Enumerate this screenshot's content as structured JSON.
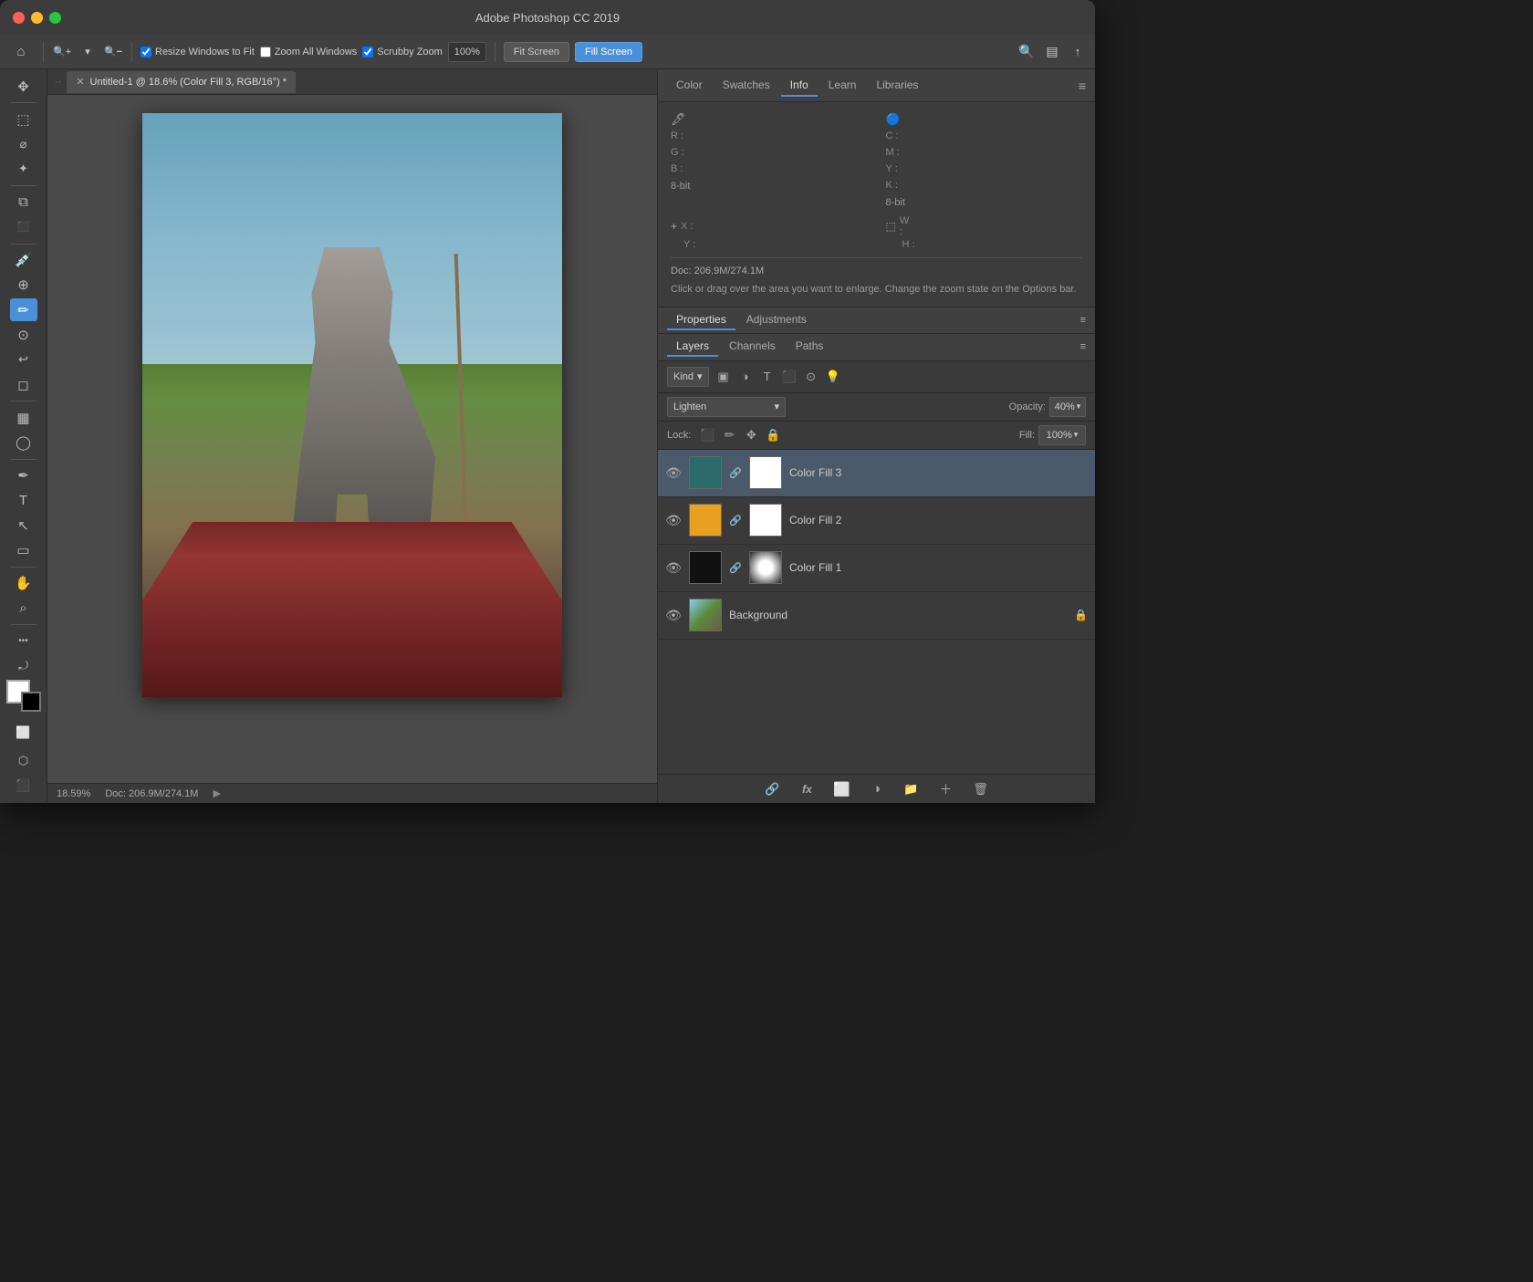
{
  "app": {
    "title": "Adobe Photoshop CC 2019"
  },
  "titlebar": {
    "title": "Adobe Photoshop CC 2019"
  },
  "optionsbar": {
    "home_icon": "⌂",
    "zoom_in_icon": "🔍",
    "zoom_out_icon": "🔍",
    "resize_windows_label": "Resize Windows to Fit",
    "resize_windows_checked": true,
    "zoom_all_windows_label": "Zoom All Windows",
    "zoom_all_windows_checked": false,
    "scrubby_zoom_label": "Scrubby Zoom",
    "scrubby_zoom_checked": true,
    "zoom_level": "100%",
    "fit_screen_label": "Fit Screen",
    "fill_screen_label": "Fill Screen",
    "search_icon": "🔍",
    "arrange_icon": "▤",
    "share_icon": "↑"
  },
  "canvas": {
    "tab_title": "Untitled-1 @ 18.6% (Color Fill 3, RGB/16°) *",
    "zoom_percent": "18.59%",
    "doc_info": "Doc: 206.9M/274.1M"
  },
  "panel_tabs": {
    "items": [
      {
        "label": "Color",
        "id": "color"
      },
      {
        "label": "Swatches",
        "id": "swatches"
      },
      {
        "label": "Info",
        "id": "info",
        "active": true
      },
      {
        "label": "Learn",
        "id": "learn"
      },
      {
        "label": "Libraries",
        "id": "libraries"
      }
    ]
  },
  "info_panel": {
    "r_label": "R :",
    "g_label": "G :",
    "b_label": "B :",
    "c_label": "C :",
    "m_label": "M :",
    "y_label": "Y :",
    "k_label": "K :",
    "bitdepth1": "8-bit",
    "bitdepth2": "8-bit",
    "x_label": "X :",
    "y_label2": "Y :",
    "w_label": "W :",
    "h_label": "H :",
    "doc_text": "Doc: 206.9M/274.1M",
    "hint_text": "Click or drag over the area you want to enlarge. Change the zoom state on the Options bar."
  },
  "properties_tabs": {
    "items": [
      {
        "label": "Properties",
        "id": "properties",
        "active": true
      },
      {
        "label": "Adjustments",
        "id": "adjustments"
      }
    ]
  },
  "layers_tabs": {
    "items": [
      {
        "label": "Layers",
        "id": "layers",
        "active": true
      },
      {
        "label": "Channels",
        "id": "channels"
      },
      {
        "label": "Paths",
        "id": "paths"
      }
    ]
  },
  "layers_toolbar": {
    "filter_kind_label": "Kind",
    "filter_dropdown_arrow": "▾",
    "blend_mode": "Lighten",
    "opacity_label": "Opacity:",
    "opacity_value": "40%",
    "lock_label": "Lock:",
    "fill_label": "Fill:",
    "fill_value": "100%"
  },
  "layers": [
    {
      "id": "color-fill-3",
      "name": "Color Fill 3",
      "thumb_color": "#2a6a6a",
      "selected": true,
      "has_mask": true
    },
    {
      "id": "color-fill-2",
      "name": "Color Fill 2",
      "thumb_color": "#e8a020",
      "selected": false,
      "has_mask": true
    },
    {
      "id": "color-fill-1",
      "name": "Color Fill 1",
      "thumb_color": "#111111",
      "selected": false,
      "has_mask": true
    },
    {
      "id": "background",
      "name": "Background",
      "thumb_color": "photo",
      "selected": false,
      "has_mask": false,
      "has_lock": true
    }
  ],
  "layers_bottom_icons": [
    {
      "name": "link-icon",
      "glyph": "🔗"
    },
    {
      "name": "fx-icon",
      "glyph": "fx"
    },
    {
      "name": "mask-icon",
      "glyph": "⬜"
    },
    {
      "name": "adjustment-icon",
      "glyph": "◑"
    },
    {
      "name": "folder-icon",
      "glyph": "📁"
    },
    {
      "name": "new-layer-icon",
      "glyph": "＋"
    },
    {
      "name": "delete-icon",
      "glyph": "🗑"
    }
  ],
  "left_tools": [
    {
      "name": "move-tool",
      "glyph": "✥"
    },
    {
      "name": "marquee-tool",
      "glyph": "⬚"
    },
    {
      "name": "lasso-tool",
      "glyph": "⌀"
    },
    {
      "name": "magic-wand-tool",
      "glyph": "✦"
    },
    {
      "name": "crop-tool",
      "glyph": "⧉"
    },
    {
      "name": "frame-tool",
      "glyph": "⬛"
    },
    {
      "name": "eyedropper-tool",
      "glyph": "🌡"
    },
    {
      "name": "spot-heal-tool",
      "glyph": "⊕"
    },
    {
      "name": "brush-tool",
      "glyph": "✏"
    },
    {
      "name": "stamp-tool",
      "glyph": "⊙"
    },
    {
      "name": "history-brush-tool",
      "glyph": "↩"
    },
    {
      "name": "eraser-tool",
      "glyph": "◻"
    },
    {
      "name": "gradient-tool",
      "glyph": "▦"
    },
    {
      "name": "dodge-tool",
      "glyph": "◯"
    },
    {
      "name": "pen-tool",
      "glyph": "✒"
    },
    {
      "name": "text-tool",
      "glyph": "T"
    },
    {
      "name": "path-select-tool",
      "glyph": "↖"
    },
    {
      "name": "rectangle-tool",
      "glyph": "▭"
    },
    {
      "name": "hand-tool",
      "glyph": "✋"
    },
    {
      "name": "zoom-tool",
      "glyph": "⌕"
    },
    {
      "name": "extra-tool",
      "glyph": "…"
    },
    {
      "name": "rotate-tool",
      "glyph": "⤾"
    }
  ]
}
